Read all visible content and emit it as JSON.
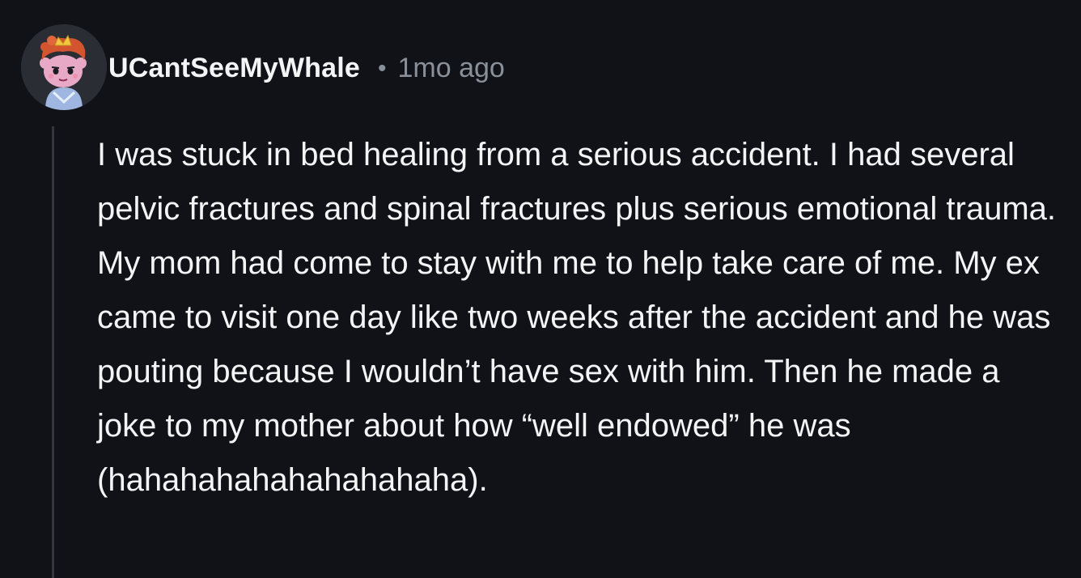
{
  "comment": {
    "author": "UCantSeeMyWhale",
    "separator": "•",
    "timestamp": "1mo ago",
    "avatar_icon": "snoo-avatar-icon",
    "body": "I was stuck in bed healing from a serious accident. I had several pelvic fractures and spinal fractures plus serious emotional trauma. My mom had come to stay with me to help take care of me. My ex came to visit one day like two weeks after the accident and he was pouting because I wouldn’t have sex with him. Then he made a joke to my mother about how “well endowed” he was (hahahahahahahahahaha)."
  },
  "colors": {
    "background": "#101217",
    "text": "#f2f4f5",
    "meta_text": "#8a9099",
    "thread_line": "#33373d"
  }
}
